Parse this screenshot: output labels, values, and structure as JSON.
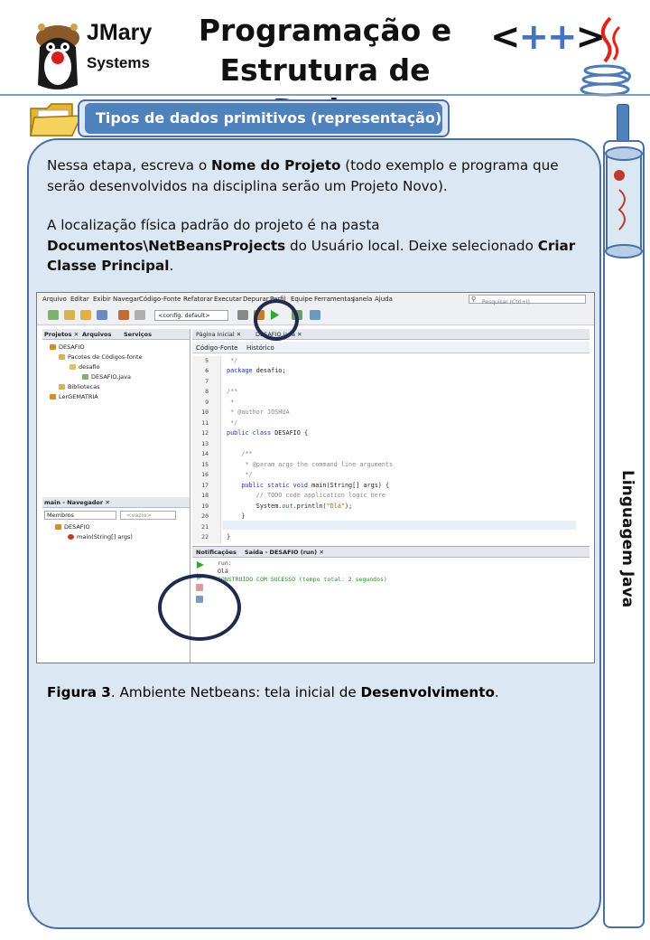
{
  "header": {
    "logo_line1": "JMary",
    "logo_line2": "Systems",
    "title_line1": "Programação e",
    "title_line2": "Estrutura de Dados",
    "cpp_open": "<",
    "cpp_plus": "++",
    "cpp_close": ">"
  },
  "section": {
    "title": "Tipos de dados primitivos (representação)"
  },
  "side": {
    "label": "Linguagem Java"
  },
  "content": {
    "p1_a": "Nessa etapa, escreva o ",
    "p1_b": "Nome do Projeto",
    "p1_c": " (todo exemplo e programa que serão desenvolvidos na disciplina serão um Projeto Novo).",
    "p2_a": "A localização física padrão do projeto é na pasta ",
    "p2_b": "Documentos\\NetBeansProjects",
    "p2_c": " do Usuário local. Deixe selecionado ",
    "p2_d": "Criar Classe Principal",
    "p2_e": ".",
    "caption_a": "Figura 3",
    "caption_b": ". Ambiente Netbeans: tela inicial de ",
    "caption_c": "Desenvolvimento",
    "caption_d": "."
  },
  "ide": {
    "menu": [
      "Arquivo",
      "Editar",
      "Exibir",
      "Navegar",
      "Código-Fonte",
      "Refatorar",
      "Executar",
      "Depurar",
      "Perfil",
      "Equipe",
      "Ferramentas",
      "Janela",
      "Ajuda"
    ],
    "search_placeholder": "Pesquisar (Ctrl+I)",
    "config": "<config. default>",
    "left_tabs": [
      "Projetos ✕",
      "Arquivos",
      "Serviços"
    ],
    "tree": [
      "DESAFIO",
      "Pacotes de Códigos-fonte",
      "desafio",
      "DESAFIO.java",
      "Bibliotecas",
      "LerGEMATRIA"
    ],
    "navigator_title": "main - Navegador ✕",
    "navigator_combo1": "Membros",
    "navigator_combo2": "<vazio>",
    "navigator_tree": [
      "DESAFIO",
      "main(String[] args)"
    ],
    "editor_tabs": [
      "Página Inicial ✕",
      "DESAFIO.java ✕"
    ],
    "editor_subtabs": [
      "Código-Fonte",
      "Histórico"
    ],
    "line_numbers": [
      "5",
      "6",
      "7",
      "8",
      "9",
      "10",
      "11",
      "12",
      "13",
      "14",
      "15",
      "16",
      "17",
      "18",
      "19",
      "20",
      "21",
      "22"
    ],
    "code": {
      "l5": " */",
      "l6_kw": "package",
      "l6_rest": " desafio;",
      "l8": "/**",
      "l9": " *",
      "l10": " * @author JOSHUA",
      "l11": " */",
      "l12_kw": "public class",
      "l12_rest": " DESAFIO {",
      "l14": "    /**",
      "l15": "     * @param args the command line arguments",
      "l16": "     */",
      "l17_kw": "    public static void",
      "l17_rest": " main(String[] args) {",
      "l18": "        // TODO code application logic here",
      "l19_a": "        System.",
      "l19_b": "out",
      "l19_c": ".println(",
      "l19_str": "\"Olá\"",
      "l19_d": ");",
      "l20": "    }",
      "l22": "}"
    },
    "output_tabs": [
      "Notificações",
      "Saída - DESAFIO (run) ✕"
    ],
    "output_lines": [
      "run:",
      "Olá",
      "CONSTRUÍDO COM SUCESSO (tempo total: 2 segundos)"
    ]
  }
}
